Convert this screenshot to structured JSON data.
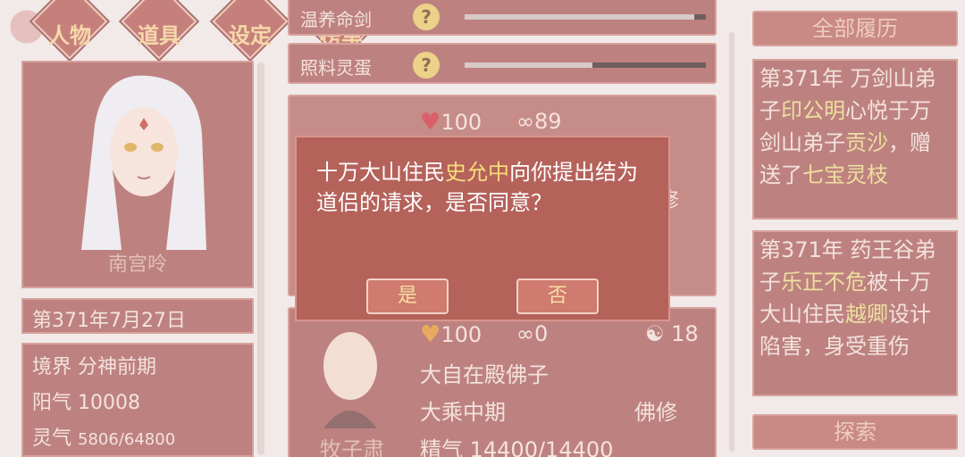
{
  "nav": {
    "items": [
      {
        "label": "人物"
      },
      {
        "label": "道具"
      },
      {
        "label": "设定"
      },
      {
        "label": "榜单"
      }
    ]
  },
  "character": {
    "name": "南宫呤",
    "date": "第371年7月27日",
    "stats": {
      "realm_label": "境界",
      "realm_value": "分神前期",
      "yang_label": "阳气",
      "yang_value": "10008",
      "ling_label": "灵气",
      "ling_value": "5806/64800"
    }
  },
  "tasks": [
    {
      "label": "温养命剑",
      "help": "?",
      "progress": 0.95
    },
    {
      "label": "照料灵蛋",
      "help": "?",
      "progress": 0.53
    }
  ],
  "companion_cards": [
    {
      "affection": "100",
      "bond": "89",
      "partial_right": "修"
    },
    {
      "affection": "100",
      "bond": "0",
      "karma": "18",
      "title": "大自在殿佛子",
      "realm": "大乘中期",
      "sect_type": "佛修",
      "name": "牧子肃",
      "essence": "精气 14400/14400"
    }
  ],
  "history": {
    "header": "全部履历",
    "entries": [
      {
        "parts": [
          {
            "t": "第371年 万剑山弟子"
          },
          {
            "t": "印公明",
            "hl": true
          },
          {
            "t": "心悦于万剑山弟子"
          },
          {
            "t": "贡沙",
            "hl": true
          },
          {
            "t": "，赠送了"
          },
          {
            "t": "七宝灵枝",
            "hl": true
          }
        ]
      },
      {
        "parts": [
          {
            "t": "第371年 药王谷弟子"
          },
          {
            "t": "乐正不危",
            "hl": true
          },
          {
            "t": "被十万大山住民"
          },
          {
            "t": "越卿",
            "hl": true
          },
          {
            "t": "设计陷害，身受重伤"
          }
        ]
      }
    ],
    "explore_label": "探索"
  },
  "dialog": {
    "msg_prefix": "十万大山住民",
    "msg_name": "史允中",
    "msg_suffix": "向你提出结为道侣的请求，是否同意？",
    "yes_label": "是",
    "no_label": "否"
  },
  "colors": {
    "panel": "#a45350",
    "dialog": "#b5625b",
    "highlight": "#e8d27a"
  }
}
